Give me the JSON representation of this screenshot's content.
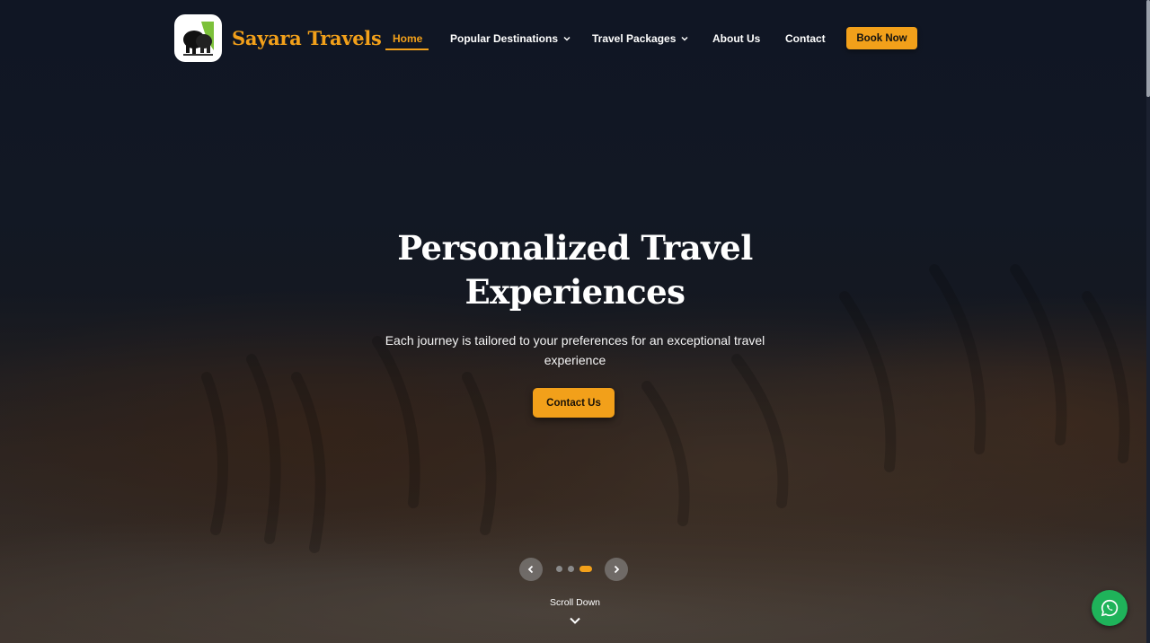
{
  "brand": {
    "name": "Sayara Travels",
    "logo_icon": "elephant-logo-icon"
  },
  "nav": {
    "items": [
      {
        "label": "Home",
        "active": true
      },
      {
        "label": "Popular Destinations",
        "dropdown": true
      },
      {
        "label": "Travel Packages",
        "dropdown": true
      },
      {
        "label": "About Us"
      },
      {
        "label": "Contact"
      }
    ],
    "cta_label": "Book Now"
  },
  "hero": {
    "headline_line1": "Personalized Travel",
    "headline_line2": "Experiences",
    "subtitle": "Each journey is tailored to your preferences for an exceptional travel experience",
    "cta_label": "Contact Us",
    "background": "sleeping-tiger-photo"
  },
  "slider": {
    "slide_count": 3,
    "active_index": 2
  },
  "scroll_hint": {
    "label": "Scroll Down"
  },
  "colors": {
    "accent": "#f2a01a",
    "whatsapp": "#1fb35a",
    "bg": "#141a27"
  },
  "floating": {
    "whatsapp_icon": "whatsapp-icon"
  }
}
